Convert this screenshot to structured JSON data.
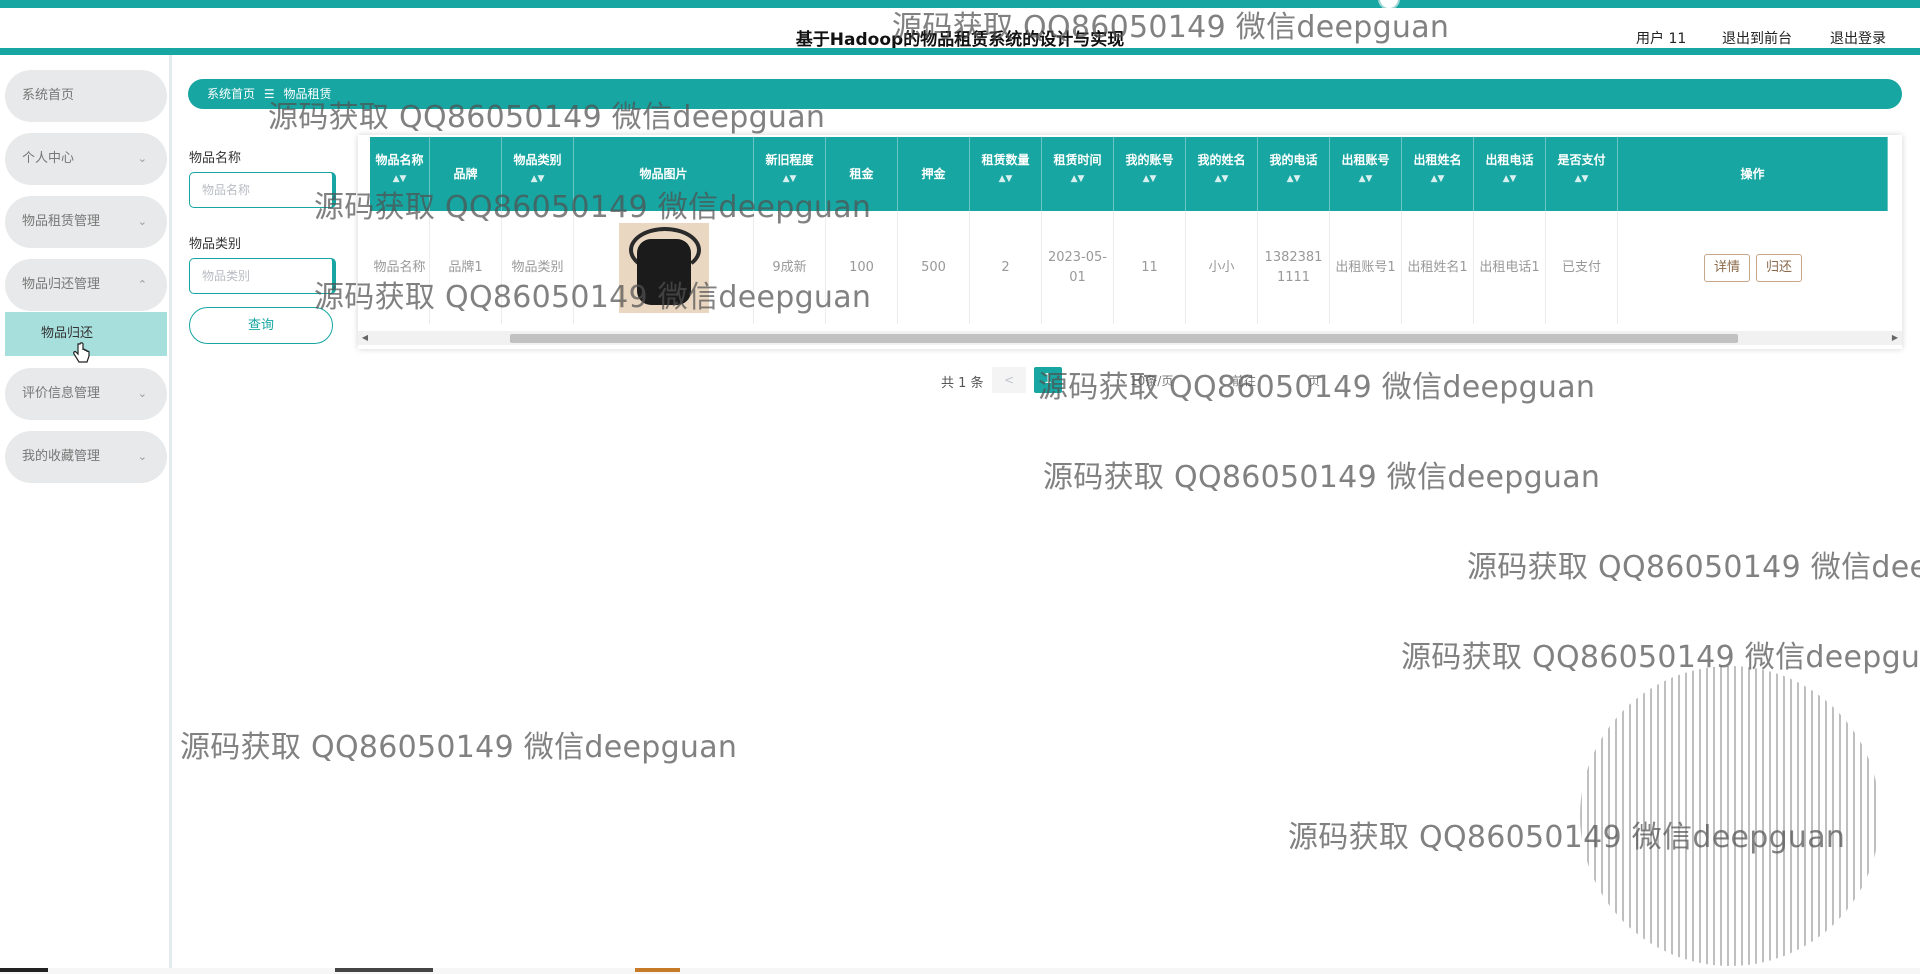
{
  "header": {
    "title": "基于Hadoop的物品租赁系统的设计与实现",
    "user_label": "用户 11",
    "back_to_front": "退出到前台",
    "logout": "退出登录"
  },
  "sidebar": {
    "items": [
      {
        "label": "系统首页",
        "chevron": ""
      },
      {
        "label": "个人中心",
        "chevron": "⌄"
      },
      {
        "label": "物品租赁管理",
        "chevron": "⌄"
      },
      {
        "label": "物品归还管理",
        "chevron": "⌃"
      },
      {
        "label": "评价信息管理",
        "chevron": "⌄"
      },
      {
        "label": "我的收藏管理",
        "chevron": "⌄"
      }
    ],
    "active_sub": "物品归还"
  },
  "breadcrumb": {
    "home": "系统首页",
    "separator": "☰",
    "current": "物品租赁"
  },
  "search": {
    "name_label": "物品名称",
    "name_placeholder": "物品名称",
    "category_label": "物品类别",
    "category_placeholder": "物品类别",
    "query_button": "查询"
  },
  "table": {
    "headers": [
      "物品名称",
      "品牌",
      "物品类别",
      "物品图片",
      "新旧程度",
      "租金",
      "押金",
      "租赁数量",
      "租赁时间",
      "我的账号",
      "我的姓名",
      "我的电话",
      "出租账号",
      "出租姓名",
      "出租电话",
      "是否支付",
      "操作"
    ],
    "rows": [
      {
        "cells": [
          "物品名称",
          "品牌1",
          "物品类别",
          "",
          "9成新",
          "100",
          "500",
          "2",
          "2023-05-01",
          "11",
          "小小",
          "13823811111",
          "出租账号1",
          "出租姓名1",
          "出租电话1",
          "已支付"
        ],
        "detail_button": "详情",
        "return_button": "归还"
      }
    ]
  },
  "pagination": {
    "total": "共 1 条",
    "prev": "<",
    "current_page": "1",
    "page_size": "10条/页",
    "goto": "前往",
    "unit": "页"
  },
  "watermark": "源码获取 QQ86050149 微信deepguan",
  "colors": {
    "accent": "#17a6a2",
    "active_sub_bg": "#a7dfdd",
    "menu_bg": "#e8e9ea"
  }
}
